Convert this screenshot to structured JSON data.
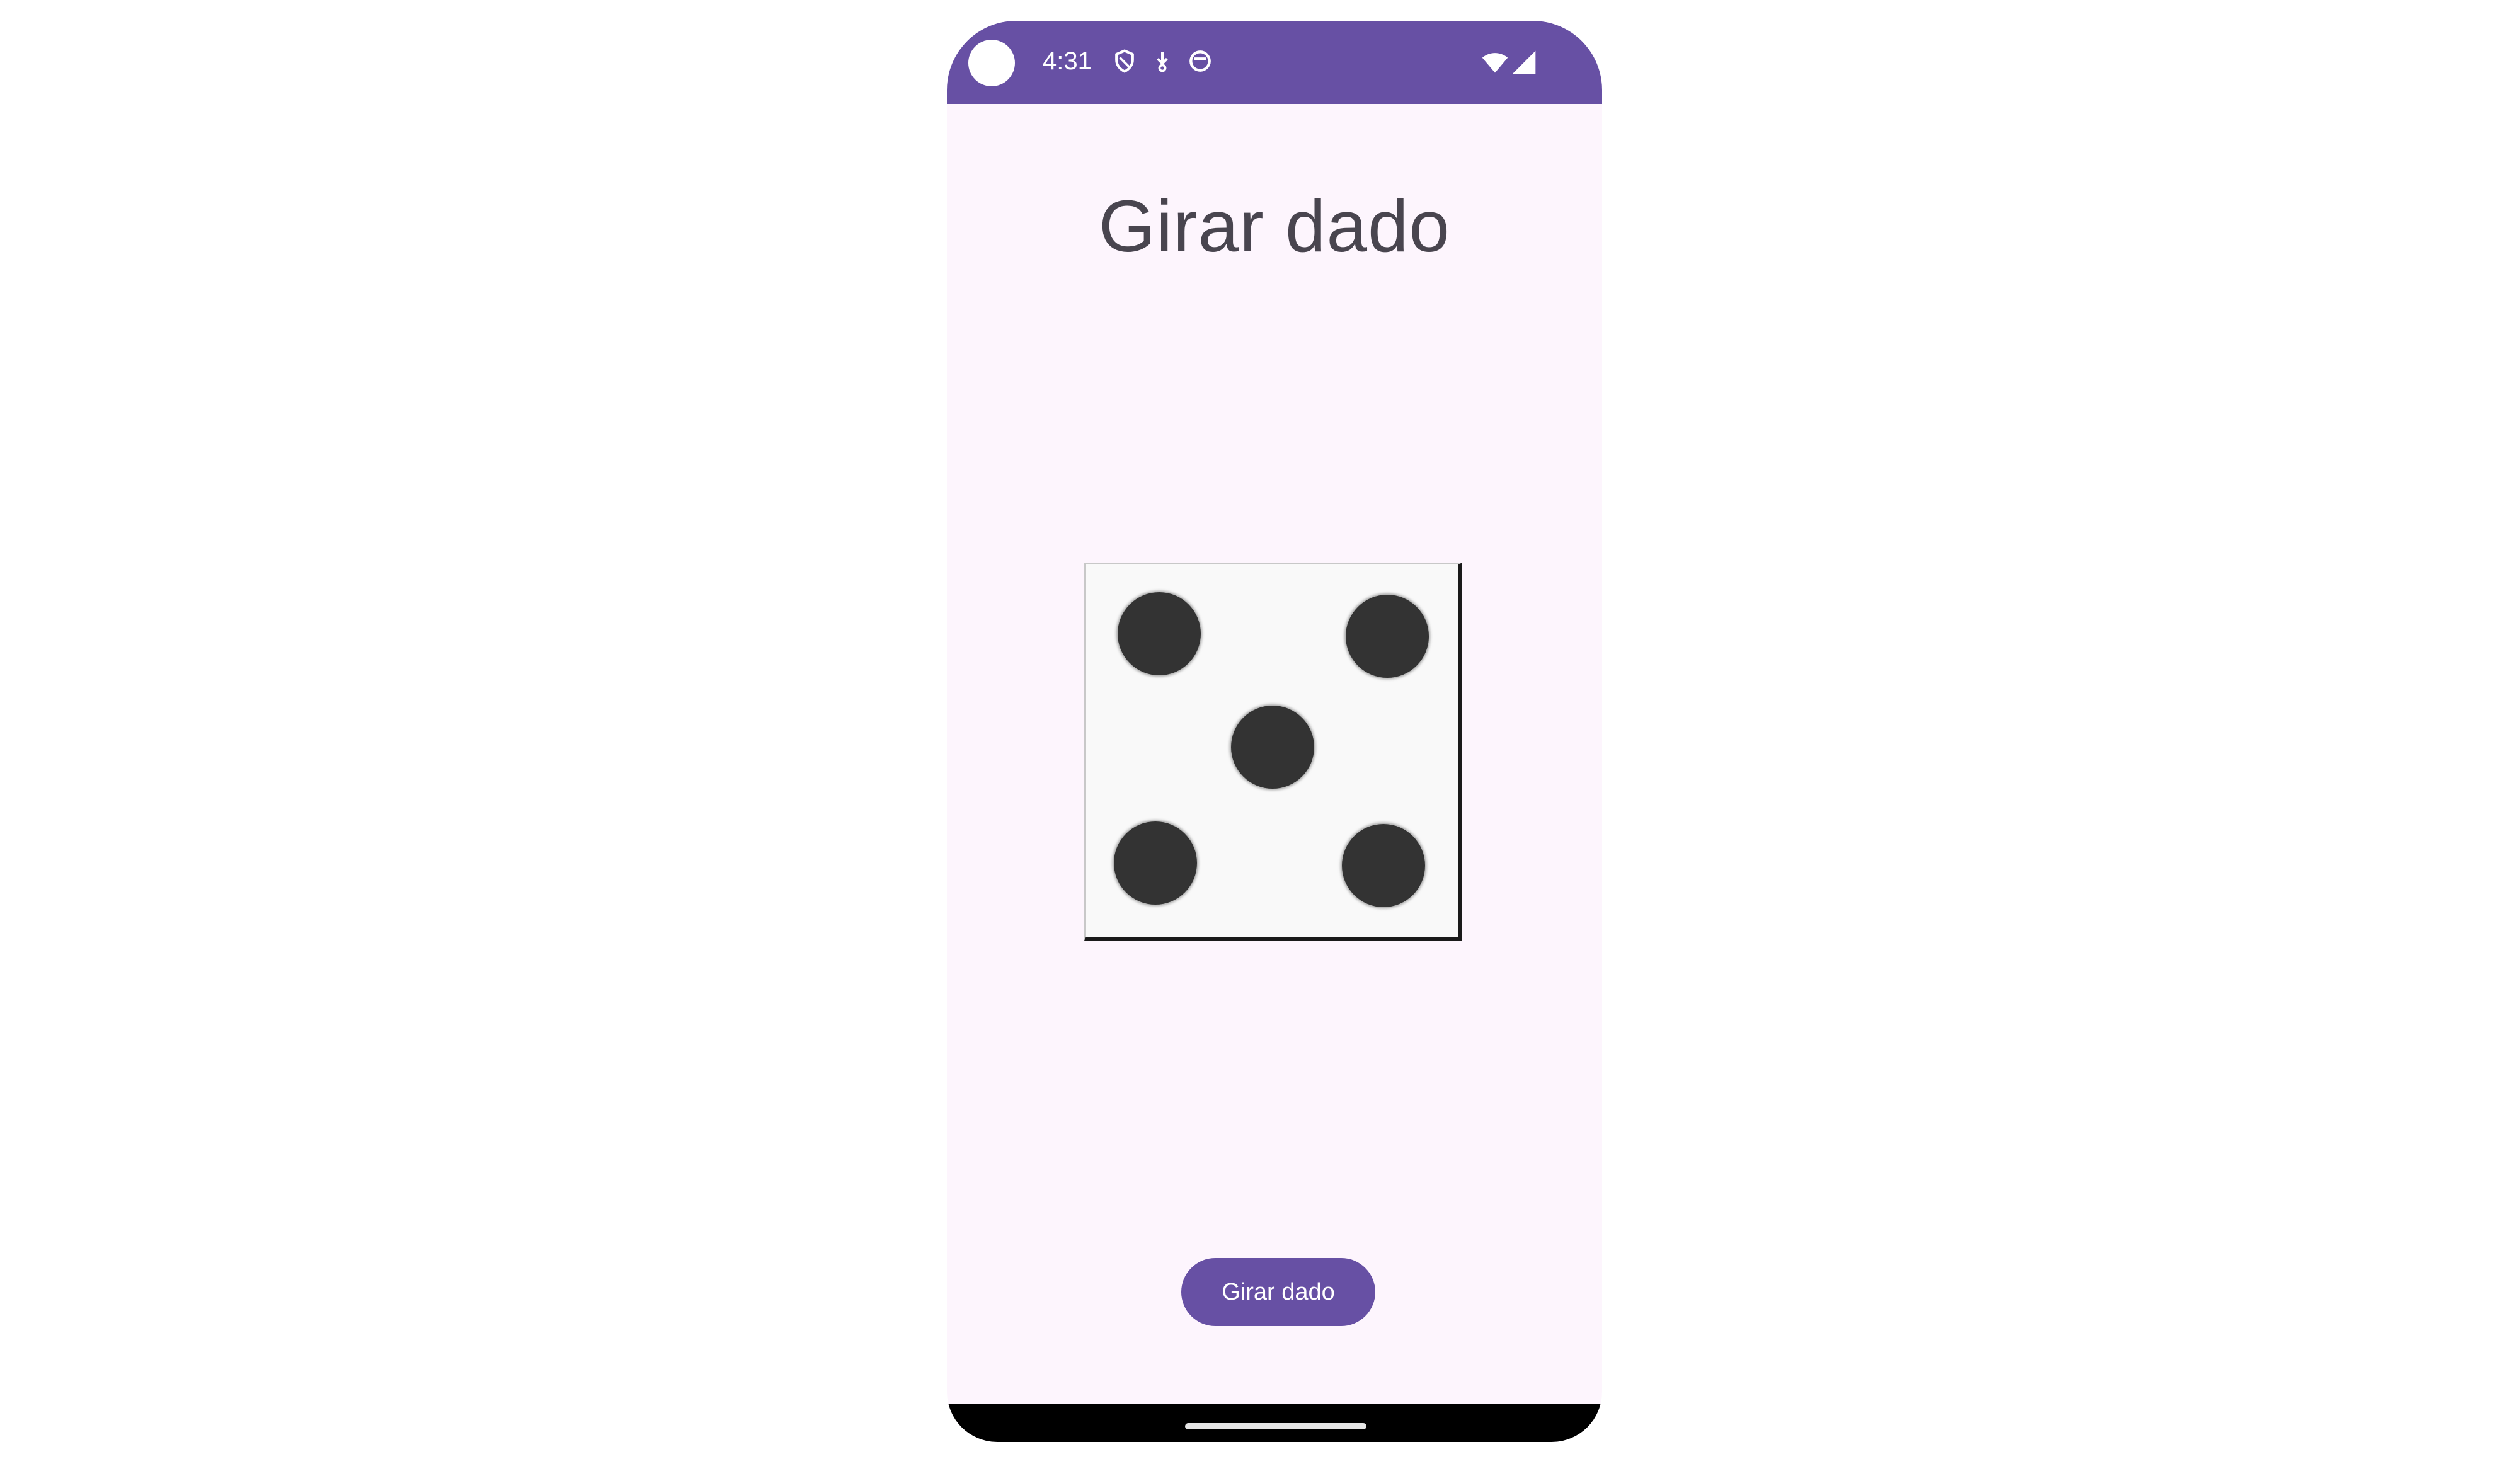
{
  "status_bar": {
    "time": "4:31",
    "background_color": "#6750a4",
    "icons": [
      "camera-cutout",
      "shield-icon",
      "download-icon",
      "circle-status-icon",
      "wifi-icon",
      "signal-icon"
    ]
  },
  "main": {
    "title": "Girar dado",
    "die": {
      "value": 5,
      "icon": "die-face-five"
    },
    "roll_button_label": "Girar dado"
  },
  "colors": {
    "accent": "#6750a4",
    "background": "#fdf5fd",
    "title_text": "#49454f",
    "pip": "#333333"
  }
}
